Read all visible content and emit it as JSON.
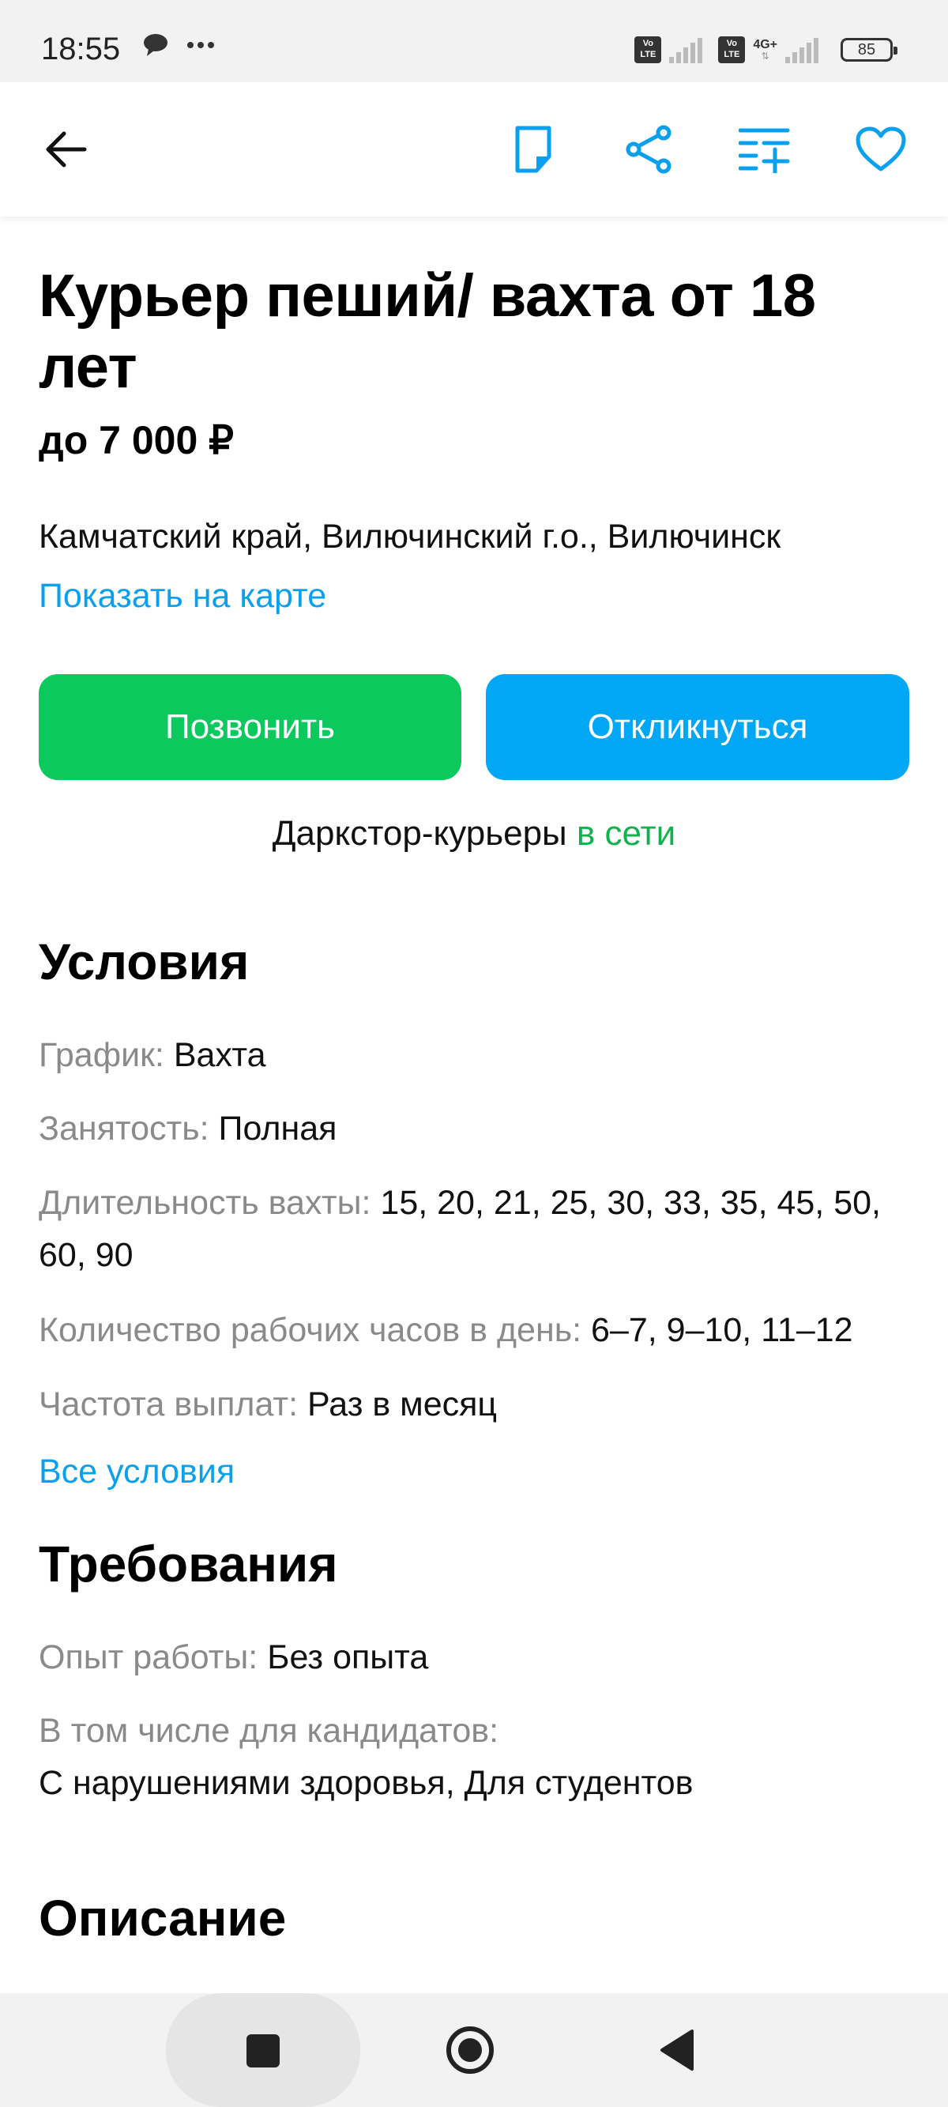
{
  "status_bar": {
    "time": "18:55",
    "network_type": "4G+",
    "volte_label": "Vo LTE",
    "battery": "85"
  },
  "app_bar": {
    "back_icon": "arrow-left-icon",
    "note_icon": "note-icon",
    "share_icon": "share-icon",
    "compare_icon": "list-add-icon",
    "favorite_icon": "heart-icon",
    "accent_color": "#0aa0f0"
  },
  "vacancy": {
    "title": "Курьер пеший/ вахта от 18 лет",
    "salary": "до 7 000 ₽",
    "address": "Камчатский край, Вилючинский г.о., Вилючинск",
    "map_link": "Показать на карте",
    "call_button": "Позвонить",
    "respond_button": "Откликнуться",
    "company": "Даркстор-курьеры",
    "online_status": "в сети"
  },
  "conditions": {
    "title": "Условия",
    "items": [
      {
        "label": "График:",
        "value": "Вахта"
      },
      {
        "label": "Занятость:",
        "value": "Полная"
      },
      {
        "label": "Длительность вахты:",
        "value": "15, 20, 21, 25, 30, 33, 35, 45, 50, 60, 90"
      },
      {
        "label": "Количество рабочих часов в день:",
        "value": "6–7, 9–10, 11–12"
      },
      {
        "label": "Частота выплат:",
        "value": "Раз в месяц"
      }
    ],
    "all_link": "Все условия"
  },
  "requirements": {
    "title": "Требования",
    "experience_label": "Опыт работы:",
    "experience_value": "Без опыта",
    "candidates_label": "В том числе для кандидатов:",
    "candidates_value": "С нарушениями здоровья, Для студентов"
  },
  "description": {
    "title": "Описание"
  },
  "colors": {
    "call_green": "#0cc95d",
    "respond_blue": "#00a7f5",
    "online_green": "#12b14e",
    "label_gray": "#8a8a8a"
  }
}
